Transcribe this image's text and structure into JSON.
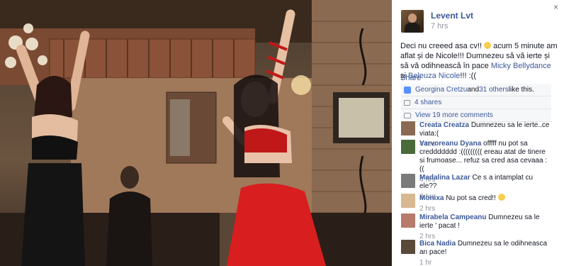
{
  "close_glyph": "×",
  "post": {
    "author": "Levent Lvt",
    "time": "7 hrs",
    "text_before": "Deci nu creeed asa cv!! ",
    "text_middle": " acum 5 minute am aflat și de Nicole!!! Dumnezeu să vă ierte și să vă odihnească în pace ",
    "mention_1": "Micky Bellydance",
    "text_and": " și ",
    "mention_2": "Beleuza Nicole",
    "text_after": "!!! :(("
  },
  "actions": {
    "share": "Share"
  },
  "ufi": {
    "likes_names": "Georgina Cretzu",
    "likes_and": " and ",
    "likes_others": "31 others",
    "likes_suffix": " like this.",
    "shares": "4 shares",
    "view_more": "View 19 more comments"
  },
  "comments": [
    {
      "name": "Creata Creatza",
      "text": "Dumnezeu sa le ierte..ce viata:(",
      "time": "4 hrs",
      "avatar_color": "#8a6a52"
    },
    {
      "name": "Varvoreanu Dyana",
      "text": "offfff nu pot sa creddddddd :((((((((( ereau atat de tinere si frumoase... refuz sa cred asa cevaaa :((",
      "time": "4 hrs",
      "avatar_color": "#4a6a3a"
    },
    {
      "name": "Madalina Lazar",
      "text": "Ce s a intamplat cu ele??",
      "time": "3 hrs",
      "avatar_color": "#7a7a7a"
    },
    {
      "name": "Monixa",
      "text": "Nu pot sa cred!!",
      "time": "2 hrs",
      "avatar_color": "#d8b890"
    },
    {
      "name": "Mirabela Campeanu",
      "text": "Dumnezeu sa le ierte ' pacat !",
      "time": "2 hrs",
      "avatar_color": "#b87a6a"
    },
    {
      "name": "Bica Nadia",
      "text": "Dumnezeu sa le odihneasca an pace!",
      "time": "1 hr",
      "avatar_color": "#5a4a3a"
    }
  ]
}
